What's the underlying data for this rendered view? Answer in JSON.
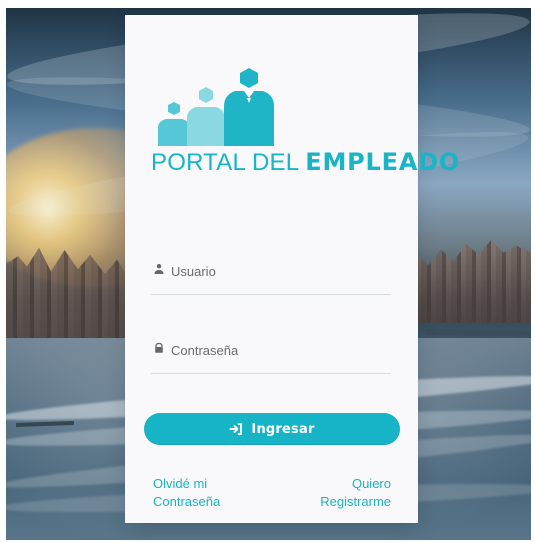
{
  "brand": {
    "primary_color": "#17b4c7",
    "portal_text": "PORTAL DEL ",
    "portal_strong_text": "EMPLEADO"
  },
  "form": {
    "username": {
      "placeholder": "Usuario",
      "value": "",
      "icon": "user-icon"
    },
    "password": {
      "placeholder": "Contraseña",
      "value": "",
      "icon": "lock-icon"
    },
    "submit": {
      "label": "Ingresar",
      "icon": "sign-in-icon"
    }
  },
  "links": {
    "forgot_password_line_1": "Olvidé mi",
    "forgot_password_line_2": "Contraseña",
    "register_line_1": "Quiero",
    "register_line_2": "Registrarme"
  }
}
